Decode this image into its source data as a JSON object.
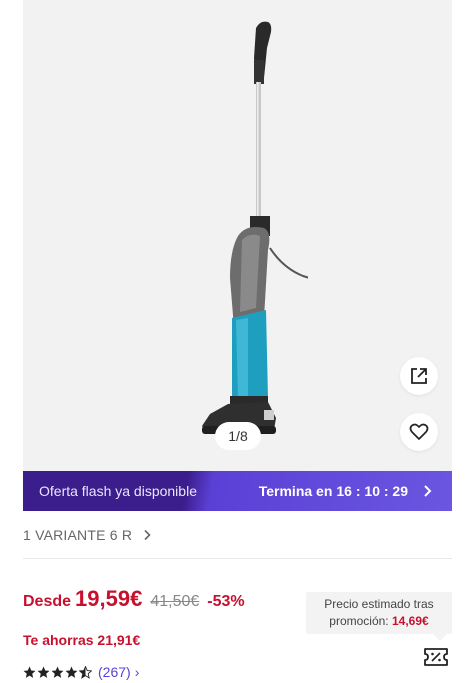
{
  "gallery": {
    "pager": "1/8",
    "image_alt": "stick vacuum cleaner"
  },
  "flash_sale": {
    "label": "Oferta flash ya disponible",
    "ends_label": "Termina en",
    "countdown": "16 : 10 : 29"
  },
  "variants": {
    "label": "1 VARIANTE 6 R"
  },
  "price": {
    "from_label": "Desde",
    "current": "19,59€",
    "original": "41,50€",
    "discount": "-53%",
    "savings": "Te ahorras 21,91€"
  },
  "promo": {
    "line1": "Precio estimado tras",
    "line2_label": "promoción:",
    "line2_price": "14,69€"
  },
  "rating": {
    "stars": 4.5,
    "count": "(267)",
    "chevron": "›"
  },
  "icons": [
    "external-link-icon",
    "heart-icon",
    "chevron-right-icon",
    "star-icon",
    "coupon-icon"
  ],
  "colors": {
    "price_red": "#c8102e",
    "flash_dark": "#3c1d8c",
    "flash_light": "#6a56e0",
    "link_purple": "#5b40d6"
  }
}
